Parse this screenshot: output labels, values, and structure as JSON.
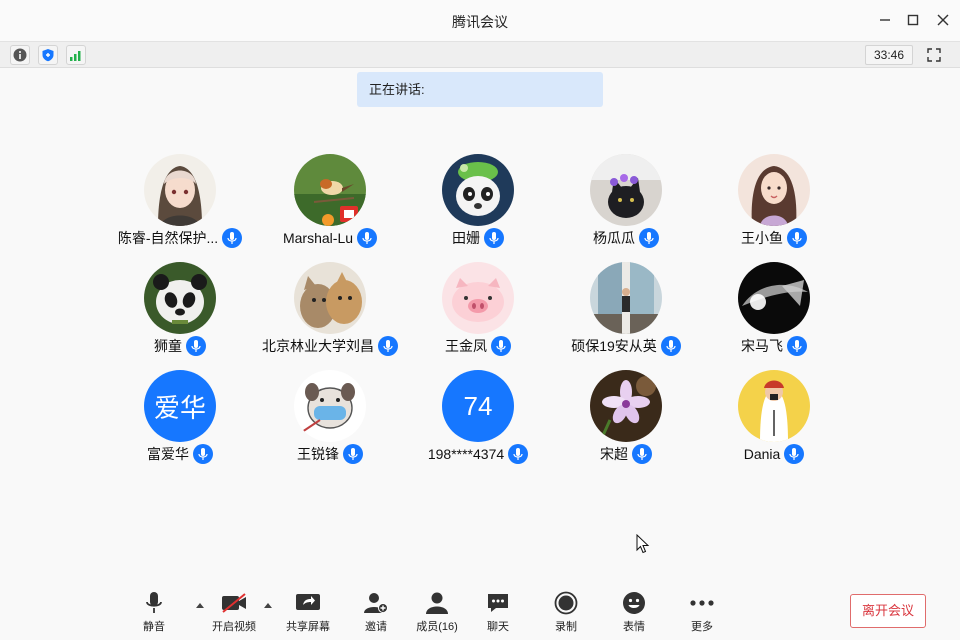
{
  "window": {
    "title": "腾讯会议"
  },
  "infobar": {
    "timer": "33:46"
  },
  "speaking": {
    "label": "正在讲话:"
  },
  "participants": [
    {
      "name": "陈睿-自然保护...",
      "avatar": "anime-girl"
    },
    {
      "name": "Marshal-Lu",
      "avatar": "bird-photo"
    },
    {
      "name": "田姗",
      "avatar": "panda-cartoon"
    },
    {
      "name": "杨瓜瓜",
      "avatar": "cat-photo"
    },
    {
      "name": "王小鱼",
      "avatar": "girl-illustration"
    },
    {
      "name": "狮童",
      "avatar": "panda-photo"
    },
    {
      "name": "北京林业大学刘昌",
      "avatar": "cats-photo"
    },
    {
      "name": "王金凤",
      "avatar": "pig-cartoon"
    },
    {
      "name": "硕保19安从英",
      "avatar": "person-window"
    },
    {
      "name": "宋马飞",
      "avatar": "abstract-dark"
    },
    {
      "name": "富爱华",
      "avatar": "text",
      "avatar_text": "爱华"
    },
    {
      "name": "王锐锋",
      "avatar": "dog-mask"
    },
    {
      "name": "198****4374",
      "avatar": "text",
      "avatar_text": "74"
    },
    {
      "name": "宋超",
      "avatar": "flower-photo"
    },
    {
      "name": "Dania",
      "avatar": "girl-yellow"
    }
  ],
  "toolbar": {
    "mute": "静音",
    "video": "开启视频",
    "share": "共享屏幕",
    "invite": "邀请",
    "members": "成员(16)",
    "chat": "聊天",
    "record": "录制",
    "emoji": "表情",
    "more": "更多",
    "leave": "离开会议"
  },
  "colors": {
    "accent": "#1677ff",
    "leave": "#d9363e",
    "speaking_bg": "#d9e8fb"
  }
}
